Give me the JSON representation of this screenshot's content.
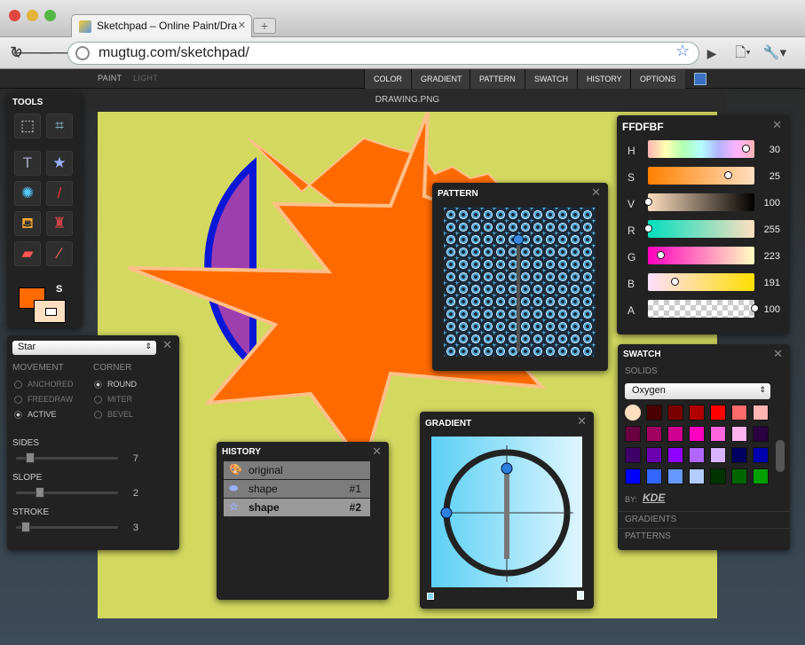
{
  "browser": {
    "tab_title": "Sketchpad – Online Paint/Dra",
    "url": "mugtug.com/sketchpad/"
  },
  "app": {
    "modes": [
      "PAINT",
      "LIGHT"
    ],
    "menu": [
      "COLOR",
      "GRADIENT",
      "PATTERN",
      "SWATCH",
      "HISTORY",
      "OPTIONS"
    ],
    "document_title": "DRAWING.PNG"
  },
  "tools": {
    "title": "TOOLS",
    "stroke_label": "S",
    "fill_color": "#ff6a00",
    "stroke_color": "#ffdfbf"
  },
  "shape_panel": {
    "shape": "Star",
    "movement_label": "MOVEMENT",
    "corner_label": "CORNER",
    "movement_options": [
      "ANCHORED",
      "FREEDRAW",
      "ACTIVE"
    ],
    "movement_selected": "ACTIVE",
    "corner_options": [
      "ROUND",
      "MITER",
      "BEVEL"
    ],
    "corner_selected": "ROUND",
    "sliders": [
      {
        "label": "SIDES",
        "value": "7",
        "level": 0.1
      },
      {
        "label": "SLOPE",
        "value": "2",
        "level": 0.2
      },
      {
        "label": "STROKE",
        "value": "3",
        "level": 0.05
      }
    ]
  },
  "color_panel": {
    "title": "FFDFBF",
    "channels": [
      {
        "label": "H",
        "value": "30",
        "level": 0.92
      },
      {
        "label": "S",
        "value": "25",
        "level": 0.75
      },
      {
        "label": "V",
        "value": "100",
        "level": 0.0
      },
      {
        "label": "R",
        "value": "255",
        "level": 0.0
      },
      {
        "label": "G",
        "value": "223",
        "level": 0.12
      },
      {
        "label": "B",
        "value": "191",
        "level": 0.25
      },
      {
        "label": "A",
        "value": "100",
        "level": 1.0
      }
    ]
  },
  "pattern_panel": {
    "title": "PATTERN"
  },
  "gradient_panel": {
    "title": "GRADIENT"
  },
  "history_panel": {
    "title": "HISTORY",
    "items": [
      {
        "label": "original",
        "num": ""
      },
      {
        "label": "shape",
        "num": "#1"
      },
      {
        "label": "shape",
        "num": "#2"
      }
    ]
  },
  "swatch_panel": {
    "title": "SWATCH",
    "solids_label": "SOLIDS",
    "palette": "Oxygen",
    "by_label": "BY:",
    "author": "KDE",
    "gradients_label": "GRADIENTS",
    "patterns_label": "PATTERNS",
    "colors": [
      "#ffdfbf",
      "#4a0000",
      "#7a0000",
      "#b00000",
      "#ff0000",
      "#ff6a6a",
      "#ffb3b3",
      "#6a0040",
      "#a00060",
      "#d00090",
      "#ff00c0",
      "#ff66dd",
      "#ffb3ee",
      "#2a0040",
      "#40006a",
      "#6a00b0",
      "#9000ff",
      "#b066ff",
      "#d9b3ff",
      "#000060",
      "#0000b0",
      "#0000ff",
      "#3366ff",
      "#6699ff",
      "#b3ccff",
      "#003300",
      "#006600",
      "#00a000"
    ]
  }
}
